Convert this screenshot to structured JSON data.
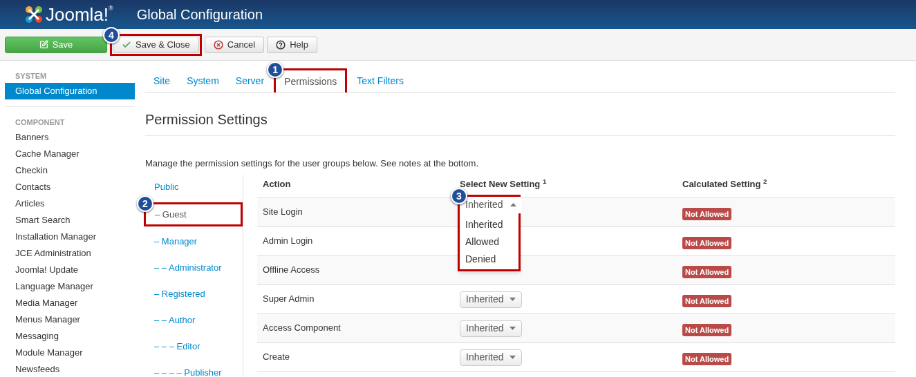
{
  "header": {
    "logo": "Joomla!",
    "logo_mark": "®",
    "title": "Global Configuration"
  },
  "toolbar": [
    {
      "kind": "save",
      "label": "Save"
    },
    {
      "kind": "save-close",
      "label": "Save & Close",
      "callout": "4"
    },
    {
      "kind": "cancel",
      "label": "Cancel"
    },
    {
      "kind": "help",
      "label": "Help"
    }
  ],
  "sidebar": {
    "sections": [
      {
        "heading": "SYSTEM",
        "items": [
          {
            "label": "Global Configuration",
            "selected": true
          }
        ]
      },
      {
        "heading": "COMPONENT",
        "items": [
          {
            "label": "Banners",
            "selected": false
          },
          {
            "label": "Cache Manager",
            "selected": false
          },
          {
            "label": "Checkin",
            "selected": false
          },
          {
            "label": "Contacts",
            "selected": false
          },
          {
            "label": "Articles",
            "selected": false
          },
          {
            "label": "Smart Search",
            "selected": false
          },
          {
            "label": "Installation Manager",
            "selected": false
          },
          {
            "label": "JCE Administration",
            "selected": false
          },
          {
            "label": "Joomla! Update",
            "selected": false
          },
          {
            "label": "Language Manager",
            "selected": false
          },
          {
            "label": "Media Manager",
            "selected": false
          },
          {
            "label": "Menus Manager",
            "selected": false
          },
          {
            "label": "Messaging",
            "selected": false
          },
          {
            "label": "Module Manager",
            "selected": false
          },
          {
            "label": "Newsfeeds",
            "selected": false
          }
        ]
      }
    ]
  },
  "tabs": [
    {
      "label": "Site",
      "selected": false
    },
    {
      "label": "System",
      "selected": false
    },
    {
      "label": "Server",
      "selected": false
    },
    {
      "label": "Permissions",
      "selected": true,
      "callout": "1"
    },
    {
      "label": "Text Filters",
      "selected": false
    }
  ],
  "section_title": "Permission Settings",
  "description": "Manage the permission settings for the user groups below. See notes at the bottom.",
  "groups": [
    {
      "label": "Public",
      "selected": false
    },
    {
      "label": "– Guest",
      "selected": true,
      "callout": "2"
    },
    {
      "label": "– Manager",
      "selected": false
    },
    {
      "label": "– – Administrator",
      "selected": false
    },
    {
      "label": "– Registered",
      "selected": false
    },
    {
      "label": "– – Author",
      "selected": false
    },
    {
      "label": "– – – Editor",
      "selected": false
    },
    {
      "label": "– – – – Publisher",
      "selected": false
    }
  ],
  "table": {
    "columns": [
      "Action",
      "Select New Setting $^{1}$",
      "Calculated Setting $^{2}$"
    ],
    "rows": [
      {
        "action": "Site Login",
        "setting": {
          "value": "Inherited",
          "expanded": true,
          "callout": "3",
          "options": [
            "Inherited",
            "Allowed",
            "Denied"
          ]
        },
        "calculated": "Not Allowed"
      },
      {
        "action": "Admin Login",
        "calculated": "Not Allowed"
      },
      {
        "action": "Offline Access",
        "calculated": "Not Allowed"
      },
      {
        "action": "Super Admin",
        "setting": {
          "value": "Inherited",
          "expanded": false
        },
        "calculated": "Not Allowed"
      },
      {
        "action": "Access Component",
        "setting": {
          "value": "Inherited",
          "expanded": false
        },
        "calculated": "Not Allowed"
      },
      {
        "action": "Create",
        "setting": {
          "value": "Inherited",
          "expanded": false
        },
        "calculated": "Not Allowed"
      }
    ]
  }
}
